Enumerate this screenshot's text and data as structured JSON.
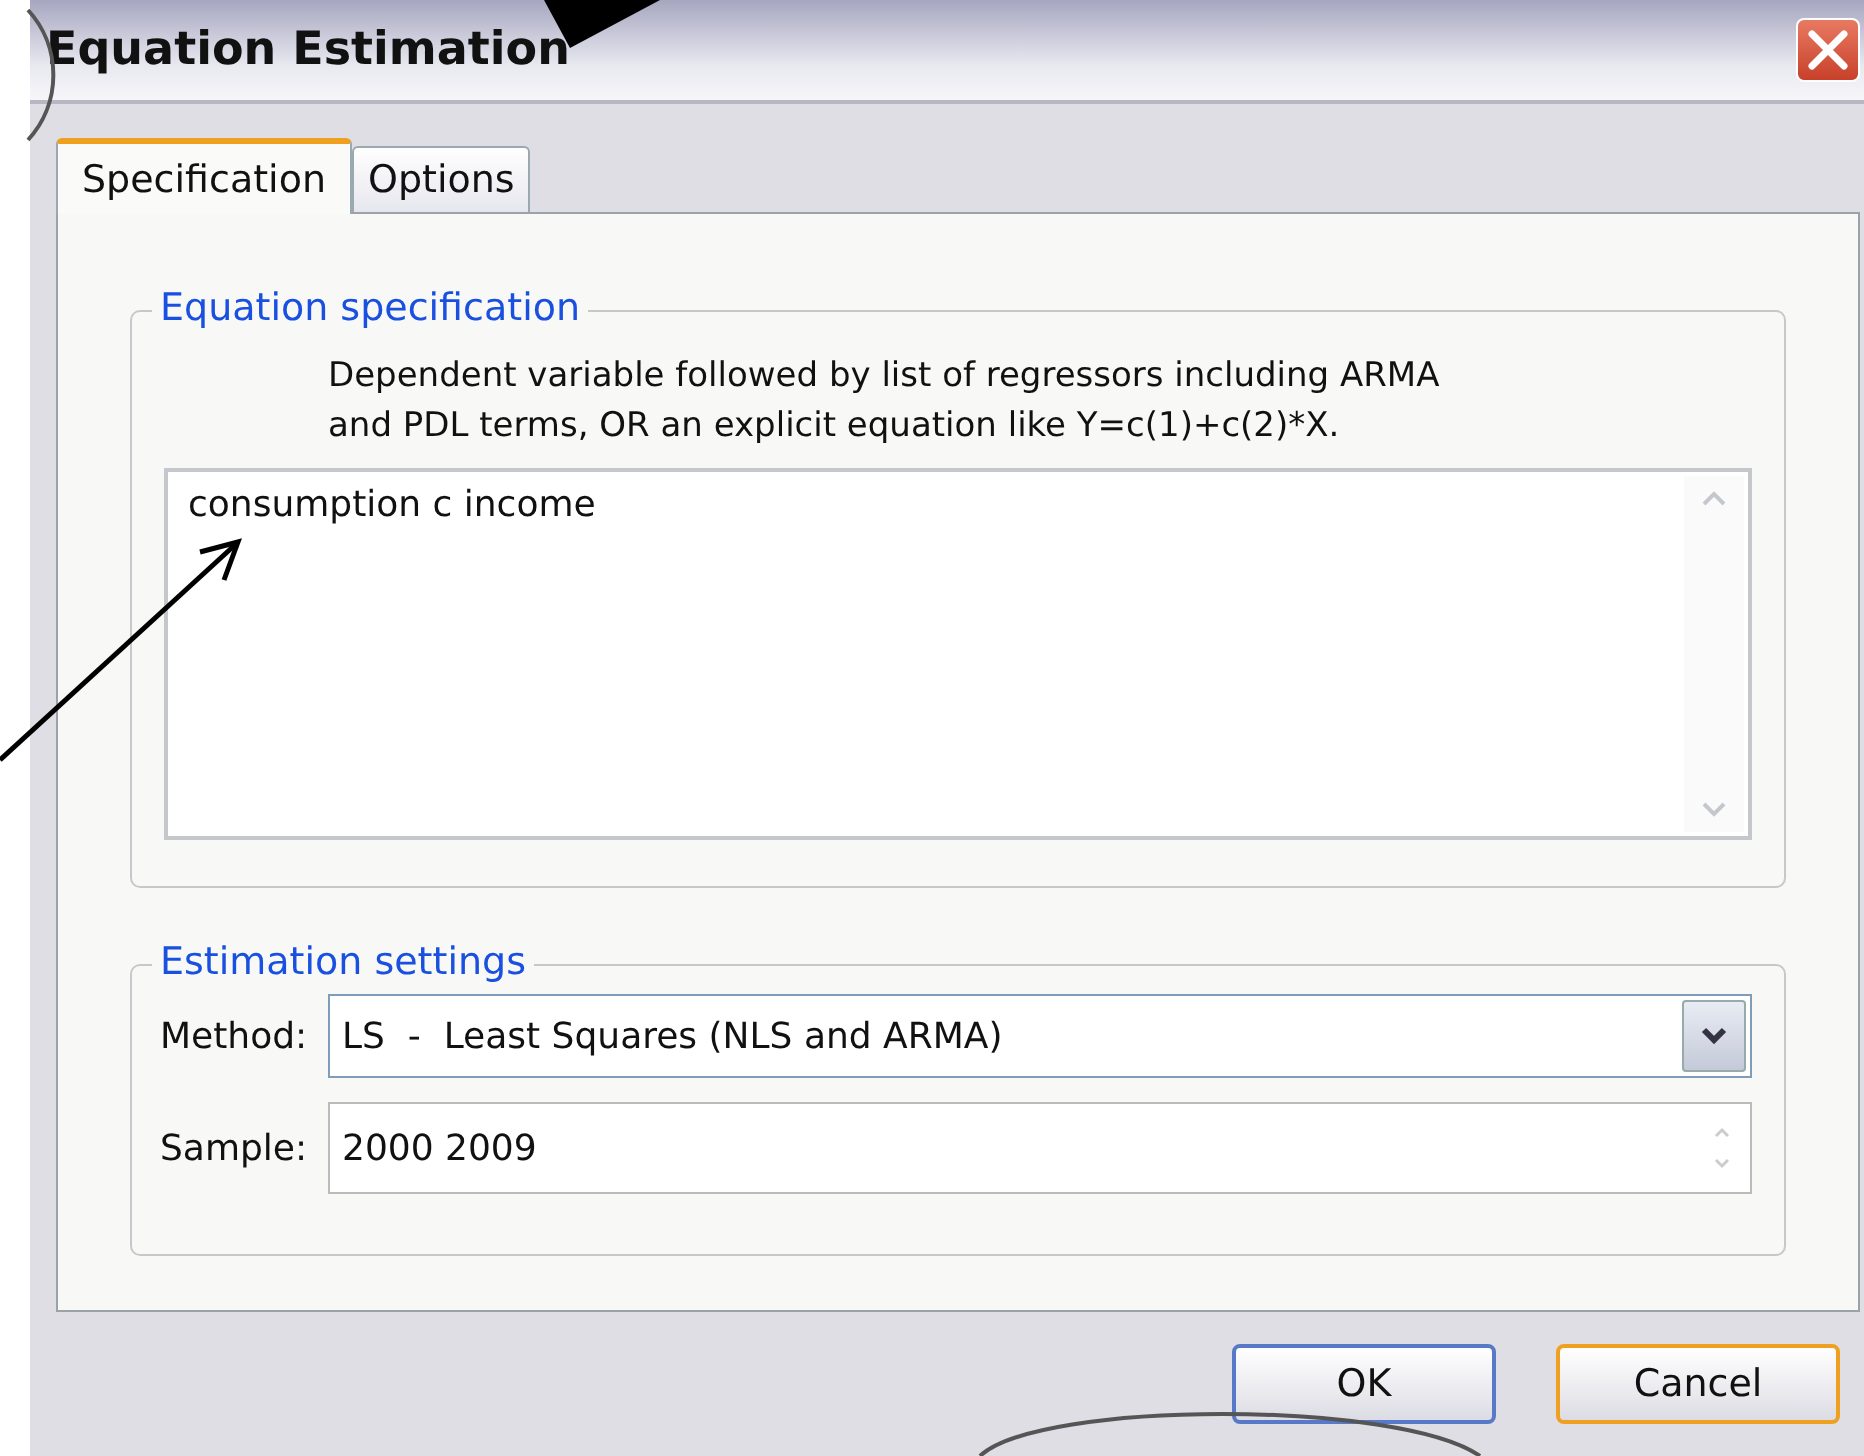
{
  "window": {
    "title": "Equation Estimation"
  },
  "tabs": [
    {
      "label": "Specification",
      "selected": true
    },
    {
      "label": "Options",
      "selected": false
    }
  ],
  "equation_specification": {
    "legend": "Equation specification",
    "hint_lines": [
      "Dependent variable followed by list of regressors including ARMA",
      "and PDL terms, OR an explicit equation like Y=c(1)+c(2)*X."
    ],
    "value": "consumption c income"
  },
  "estimation_settings": {
    "legend": "Estimation settings",
    "method": {
      "label": "Method:",
      "value": "LS  -  Least Squares (NLS and ARMA)"
    },
    "sample": {
      "label": "Sample:",
      "value": "2000 2009"
    }
  },
  "buttons": [
    {
      "label": "OK",
      "focused": false
    },
    {
      "label": "Cancel",
      "focused": true
    }
  ]
}
